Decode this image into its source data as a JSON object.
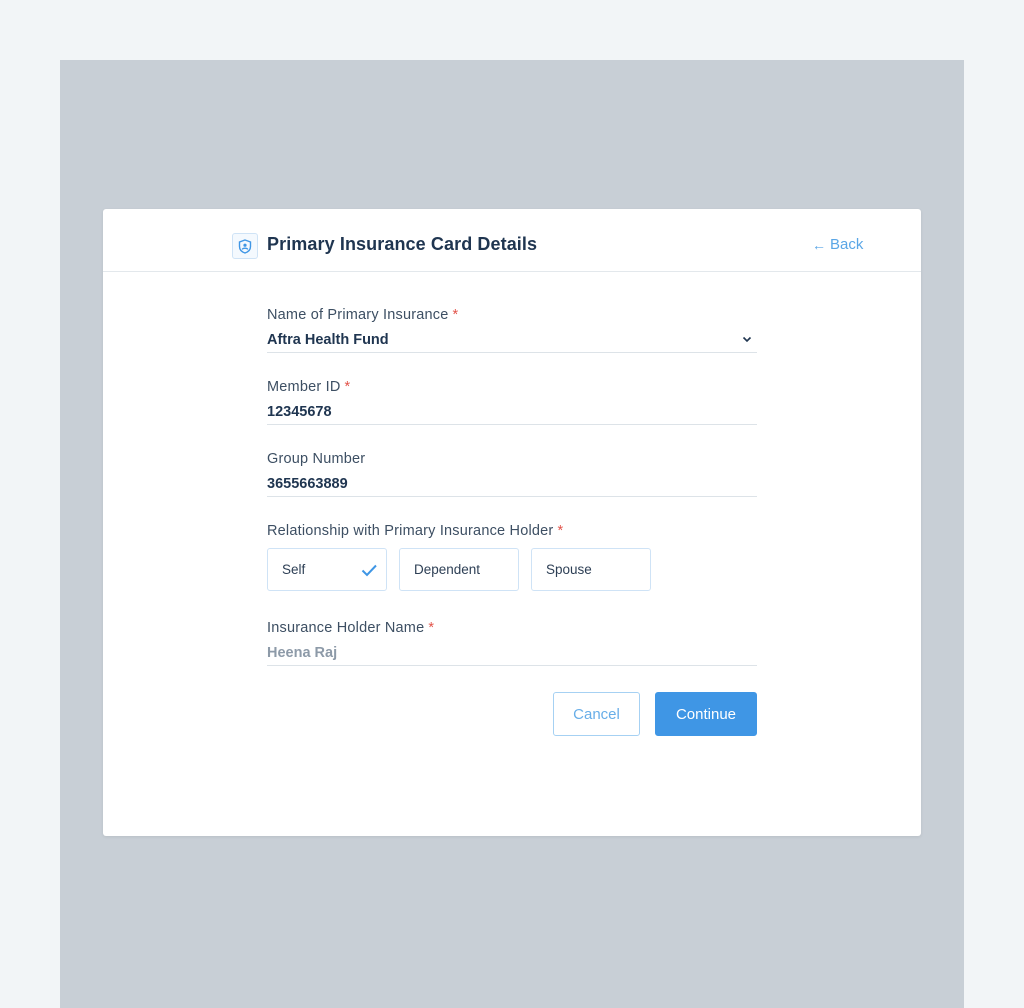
{
  "header": {
    "title": "Primary Insurance Card Details",
    "back_label": "Back",
    "icon": "shield-user-icon"
  },
  "form": {
    "insurance": {
      "label": "Name of Primary Insurance",
      "required_mark": "*",
      "value": "Aftra Health Fund"
    },
    "member_id": {
      "label": "Member ID",
      "required_mark": "*",
      "value": "12345678"
    },
    "group_number": {
      "label": "Group Number",
      "value": "3655663889"
    },
    "relationship": {
      "label": "Relationship with Primary Insurance Holder",
      "required_mark": "*",
      "options": [
        {
          "label": "Self",
          "selected": true
        },
        {
          "label": "Dependent",
          "selected": false
        },
        {
          "label": "Spouse",
          "selected": false
        }
      ]
    },
    "holder_name": {
      "label": "Insurance Holder Name",
      "required_mark": "*",
      "value": "Heena Raj"
    }
  },
  "actions": {
    "cancel_label": "Cancel",
    "continue_label": "Continue"
  },
  "colors": {
    "accent": "#3f96e5",
    "required": "#e2534a",
    "backdrop": "#c8cfd6",
    "page": "#f2f5f7"
  }
}
